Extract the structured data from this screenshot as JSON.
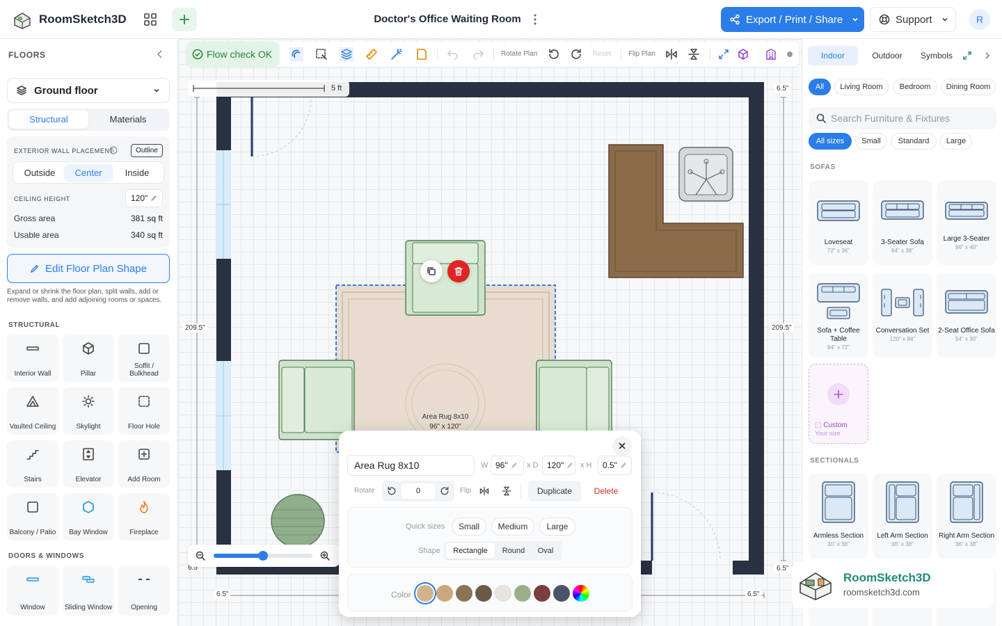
{
  "header": {
    "app_name": "RoomSketch3D",
    "plan_title": "Doctor's Office Waiting Room",
    "export_label": "Export / Print / Share",
    "support_label": "Support",
    "avatar_initial": "R"
  },
  "left": {
    "floors_title": "FLOORS",
    "floor_selected": "Ground floor",
    "tabs": [
      "Structural",
      "Materials"
    ],
    "wall_placement_label": "EXTERIOR WALL PLACEMENT",
    "outline_badge": "Outline",
    "placement_options": [
      "Outside",
      "Center",
      "Inside"
    ],
    "ceiling_label": "CEILING HEIGHT",
    "ceiling_value": "120\"",
    "gross_label": "Gross area",
    "gross_value": "381 sq ft",
    "usable_label": "Usable area",
    "usable_value": "340 sq ft",
    "edit_shape_label": "Edit Floor Plan Shape",
    "edit_shape_help": "Expand or shrink the floor plan, split walls, add or remove walls, and add adjoining rooms or spaces.",
    "structural_title": "STRUCTURAL",
    "structural_tools": [
      "Interior Wall",
      "Pillar",
      "Soffit / Bulkhead",
      "Vaulted Ceiling",
      "Skylight",
      "Floor Hole",
      "Stairs",
      "Elevator",
      "Add Room",
      "Balcony / Patio",
      "Bay Window",
      "Fireplace"
    ],
    "doors_title": "DOORS & WINDOWS",
    "door_tools": [
      "Window",
      "Sliding Window",
      "Opening"
    ]
  },
  "toolbar": {
    "flow_check": "Flow check OK",
    "rotate_plan": "Rotate Plan",
    "reset": "Reset",
    "flip_plan": "Flip Plan"
  },
  "canvas": {
    "scale_label": "5 ft",
    "dim_top_right": "6.5\"",
    "dim_left": "209.5\"",
    "dim_right": "209.5\"",
    "dim_bottom_left": "6.5\"",
    "dim_bottom_right": "6.5\"",
    "dim_corner_left": "6.5\"",
    "dim_corner_right": "6.5\"",
    "rug_label": "Area Rug 8x10",
    "rug_size": "96\" x 120\"",
    "zoom_level": 0.5
  },
  "popup": {
    "name": "Area Rug 8x10",
    "w_label": "W",
    "w_value": "96\"",
    "d_label": "x D",
    "d_value": "120\"",
    "h_label": "x H",
    "h_value": "0.5\"",
    "rotate_label": "Rotate",
    "rotate_value": "0",
    "flip_label": "Flip",
    "duplicate_label": "Duplicate",
    "delete_label": "Delete",
    "quick_sizes_label": "Quick sizes",
    "quick_sizes": [
      "Small",
      "Medium",
      "Large"
    ],
    "shape_label": "Shape",
    "shapes": [
      "Rectangle",
      "Round",
      "Oval"
    ],
    "color_label": "Color",
    "colors": [
      "#d2b48c",
      "#c9a87c",
      "#8b7355",
      "#6b5a48",
      "#e8e4de",
      "#9bb08a",
      "#7a3e3e",
      "#4a5468"
    ]
  },
  "right": {
    "tabs": [
      "Indoor",
      "Outdoor",
      "Symbols"
    ],
    "rooms": [
      "All",
      "Living Room",
      "Bedroom",
      "Dining Room"
    ],
    "search_placeholder": "Search Furniture & Fixtures",
    "sizes": [
      "All sizes",
      "Small",
      "Standard",
      "Large"
    ],
    "sofas_title": "SOFAS",
    "sofas": [
      {
        "name": "Loveseat",
        "dims": "72\" x 36\""
      },
      {
        "name": "3-Seater Sofa",
        "dims": "84\" x 38\""
      },
      {
        "name": "Large 3-Seater",
        "dims": "96\" x 40\""
      },
      {
        "name": "Sofa + Coffee Table",
        "dims": "84\" x 72\""
      },
      {
        "name": "Conversation Set",
        "dims": "120\" x 84\""
      },
      {
        "name": "2-Seat Office Sofa",
        "dims": "54\" x 30\""
      }
    ],
    "custom_label": "Custom",
    "custom_sub": "Your size",
    "sectionals_title": "SECTIONALS",
    "sectionals": [
      {
        "name": "Armless Section",
        "dims": "30\" x 38\""
      },
      {
        "name": "Left Arm Section",
        "dims": "36\" x 38\""
      },
      {
        "name": "Right Arm Section",
        "dims": "36\" x 38\""
      }
    ],
    "watermark_name": "RoomSketch3D",
    "watermark_url": "roomsketch3d.com"
  }
}
